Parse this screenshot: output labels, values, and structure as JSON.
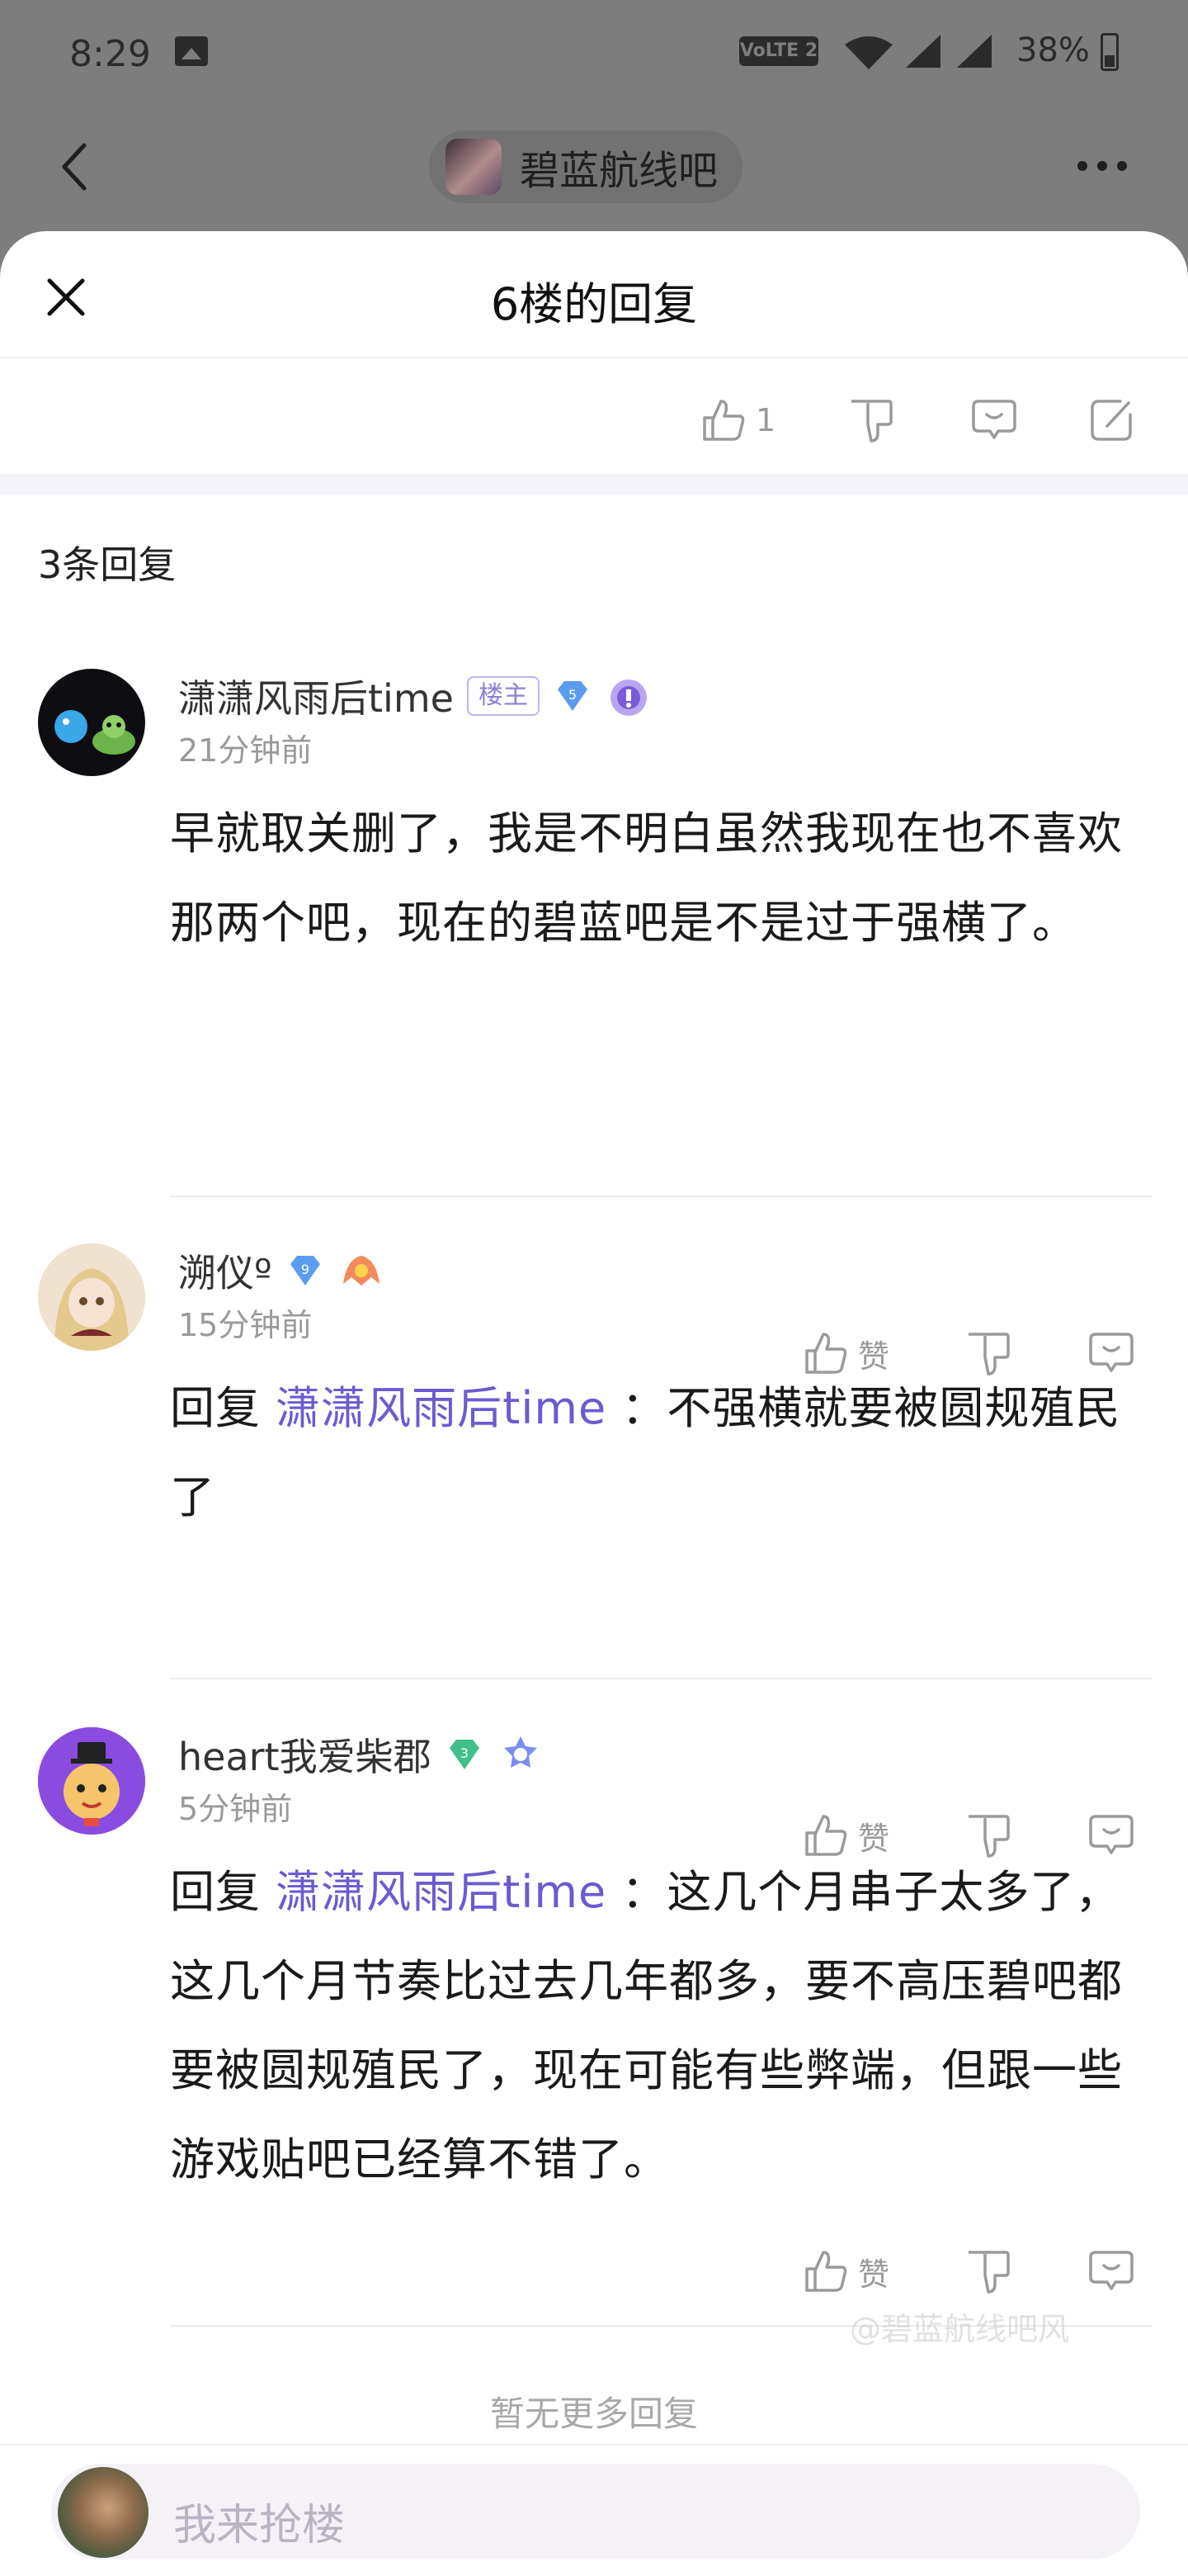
{
  "status_bar": {
    "time": "8:29",
    "network_badge": "VoLTE 2",
    "battery": "38%"
  },
  "app_header": {
    "forum_name": "碧蓝航线吧"
  },
  "sheet": {
    "title": "6楼的回复",
    "op_actions": {
      "like_count": "1"
    },
    "reply_count_label": "3条回复",
    "comments": [
      {
        "username": "潇潇风雨后time",
        "owner_badge": "楼主",
        "level": "5",
        "time": "21分钟前",
        "text": "早就取关删了，我是不明白虽然我现在也不喜欢那两个吧，现在的碧蓝吧是不是过于强横了。",
        "like_label": "赞"
      },
      {
        "username": "溯仪º",
        "level": "9",
        "time": "15分钟前",
        "reply_prefix": "回复",
        "mention": "潇潇风雨后time",
        "text": "：不强横就要被圆规殖民了",
        "like_label": "赞"
      },
      {
        "username": "heart我爱柴郡",
        "level": "3",
        "time": "5分钟前",
        "reply_prefix": "回复",
        "mention": "潇潇风雨后time",
        "text": "：这几个月串子太多了，这几个月节奏比过去几年都多，要不高压碧吧都要被圆规殖民了，现在可能有些弊端，但跟一些游戏贴吧已经算不错了。",
        "like_label": "赞"
      }
    ],
    "no_more_label": "暂无更多回复"
  },
  "bottom_bar": {
    "input_placeholder": "我来抢楼",
    "watermark": "@碧蓝航线吧风"
  },
  "colors": {
    "mention": "#6a5bd0",
    "owner_badge": "#8b7fd8",
    "overlay": "#7d7d7d"
  }
}
